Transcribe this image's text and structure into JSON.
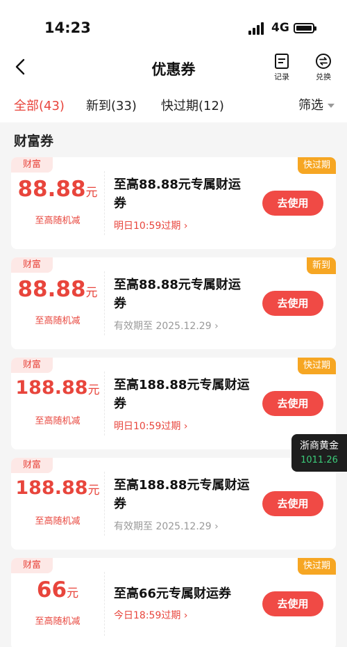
{
  "status_bar": {
    "time": "14:23",
    "network": "4G"
  },
  "nav": {
    "title": "优惠券",
    "record_label": "记录",
    "exchange_label": "兑换"
  },
  "tabs": [
    {
      "label": "全部(43)"
    },
    {
      "label": "新到(33)"
    },
    {
      "label": "快过期(12)"
    }
  ],
  "filter_label": "筛选",
  "section_title": "财富券",
  "accent_color": "#e8453c",
  "coupons": [
    {
      "category": "财富",
      "badge": "快过期",
      "amount": "88.88",
      "unit": "元",
      "sub": "至高随机减",
      "title": "至高88.88元专属财运券",
      "expiry": "明日10:59过期",
      "button": "去使用"
    },
    {
      "category": "财富",
      "badge": "新到",
      "amount": "88.88",
      "unit": "元",
      "sub": "至高随机减",
      "title": "至高88.88元专属财运券",
      "expiry": "有效期至 2025.12.29",
      "button": "去使用"
    },
    {
      "category": "财富",
      "badge": "快过期",
      "amount": "188.88",
      "unit": "元",
      "sub": "至高随机减",
      "title": "至高188.88元专属财运券",
      "expiry": "明日10:59过期",
      "button": "去使用"
    },
    {
      "category": "财富",
      "badge": "",
      "amount": "188.88",
      "unit": "元",
      "sub": "至高随机减",
      "title": "至高188.88元专属财运券",
      "expiry": "有效期至 2025.12.29",
      "button": "去使用"
    },
    {
      "category": "财富",
      "badge": "快过期",
      "amount": "66",
      "unit": "元",
      "sub": "至高随机减",
      "title": "至高66元专属财运券",
      "expiry": "今日18:59过期",
      "button": "去使用"
    }
  ],
  "gold_widget": {
    "name": "浙商黄金",
    "price": "1011.26"
  }
}
